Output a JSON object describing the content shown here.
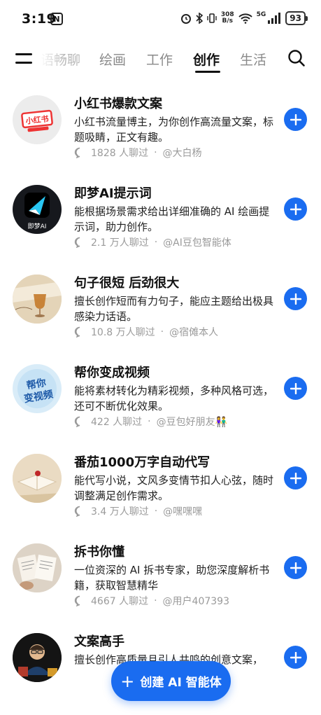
{
  "status_bar": {
    "time": "3:19",
    "nfc": "N",
    "net_speed_top": "308",
    "net_speed_bottom": "B/s",
    "signal": "5G",
    "battery": "93"
  },
  "tabs": [
    {
      "label": "语畅聊",
      "state": "partial"
    },
    {
      "label": "绘画",
      "state": "normal"
    },
    {
      "label": "工作",
      "state": "normal"
    },
    {
      "label": "创作",
      "state": "active"
    },
    {
      "label": "生活",
      "state": "normal"
    }
  ],
  "agents": [
    {
      "title": "小红书爆款文案",
      "desc": "小红书流量博主，为你创作高流量文案，标题吸睛，正文有趣。",
      "chats": "1828 人聊过",
      "author": "@大白杨",
      "avatar_text": "小红书",
      "avatar_icon": "xiaohongshu-logo-icon"
    },
    {
      "title": "即梦AI提示词",
      "desc": "能根据场景需求给出详细准确的 AI 绘画提示词，助力创作。",
      "chats": "2.1 万人聊过",
      "author": "@AI豆包智能体",
      "avatar_text": "即梦AI",
      "avatar_icon": "jimeng-logo-icon"
    },
    {
      "title": "句子很短 后劲很大",
      "desc": "擅长创作短而有力句子，能应主题给出极具感染力话语。",
      "chats": "10.8 万人聊过",
      "author": "@宿傩本人",
      "avatar_text": "",
      "avatar_icon": "wine-glass-icon"
    },
    {
      "title": "帮你变成视频",
      "desc": "能将素材转化为精彩视频，多种风格可选，还可不断优化效果。",
      "chats": "422 人聊过",
      "author": "@豆包好朋友👫",
      "avatar_text": "帮你变视频",
      "avatar_icon": "video-text-icon"
    },
    {
      "title": "番茄1000万字自动代写",
      "desc": "能代写小说，文风多变情节扣人心弦，随时调整满足创作需求。",
      "chats": "3.4 万人聊过",
      "author": "@嘿嘿嘿",
      "avatar_text": "",
      "avatar_icon": "open-book-icon"
    },
    {
      "title": "拆书你懂",
      "desc": "一位资深的 AI 拆书专家，助您深度解析书籍，获取智慧精华",
      "chats": "4667 人聊过",
      "author": "@用户407393",
      "avatar_text": "",
      "avatar_icon": "reading-book-icon"
    },
    {
      "title": "文案高手",
      "desc": "擅长创作高质量且引人共鸣的创意文案，",
      "chats": "",
      "author": "",
      "avatar_text": "",
      "avatar_icon": "writer-portrait-icon"
    }
  ],
  "create_button": {
    "label": "创建 AI 智能体"
  },
  "colors": {
    "accent": "#1a6cf0",
    "meta_text": "#9a9a9a"
  }
}
